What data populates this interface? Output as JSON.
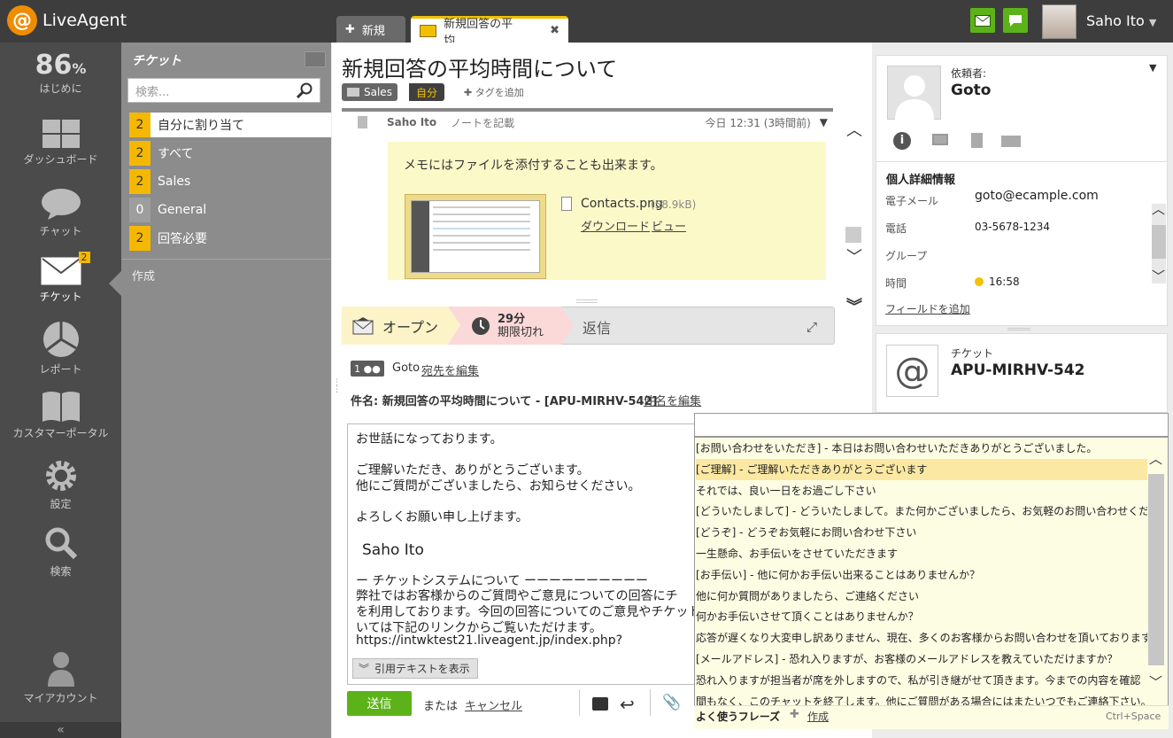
{
  "app": {
    "name": "LiveAgent",
    "user_name": "Saho Ito"
  },
  "tabs": [
    {
      "label": "新規"
    },
    {
      "label": "新規回答の平均..."
    }
  ],
  "nav": {
    "percent": "86",
    "percent_sign": "%",
    "items": [
      {
        "label": "はじめに",
        "icon": "progress"
      },
      {
        "label": "ダッシュボード",
        "icon": "dashboard-icon"
      },
      {
        "label": "チャット",
        "icon": "chat-bubble-icon"
      },
      {
        "label": "チケット",
        "icon": "envelope-icon",
        "badge": "2"
      },
      {
        "label": "レポート",
        "icon": "pie-chart-icon"
      },
      {
        "label": "カスタマーポータル",
        "icon": "book-icon"
      },
      {
        "label": "設定",
        "icon": "gear-icon"
      },
      {
        "label": "検索",
        "icon": "magnifier-icon"
      },
      {
        "label": "マイアカウント",
        "icon": "person-icon"
      }
    ],
    "collapse": "«"
  },
  "filters": {
    "title": "チケット",
    "search_placeholder": "検索...",
    "items": [
      {
        "count": "2",
        "label": "自分に割り当て"
      },
      {
        "count": "2",
        "label": "すべて"
      },
      {
        "count": "2",
        "label": "Sales"
      },
      {
        "count": "0",
        "label": "General"
      },
      {
        "count": "2",
        "label": "回答必要"
      }
    ],
    "create": "作成"
  },
  "ticket": {
    "title": "新規回答の平均時間について",
    "department": "Sales",
    "owner_tag": "自分",
    "add_tag": "タグを追加",
    "note": {
      "author": "Saho Ito",
      "action": "ノートを記載",
      "time": "今日 12:31 (3時間前)",
      "text": "メモにはファイルを添付することも出来ます。",
      "file_name": "Contacts.png",
      "file_size": "(58.9kB)",
      "download": "ダウンロード",
      "view": "ビュー"
    },
    "status": {
      "open": "オープン",
      "due_time": "29分",
      "due_label": "期限切れ",
      "reply": "返信"
    },
    "recipients": {
      "count": "1",
      "name": "Goto",
      "edit": "宛先を編集"
    },
    "subject": "件名: 新規回答の平均時間について - [APU-MIRHV-542]",
    "subject_edit": "件名を編集",
    "body": [
      "お世話になっております。",
      "ご理解いただき、ありがとうございます。",
      "他にご質問がございましたら、お知らせください。",
      "よろしくお願い申し上げます。",
      "Saho Ito",
      "ー  チケットシステムについて  ーーーーーーーーーー",
      "弊社ではお客様からのご質問やご意見についての回答にチ",
      "を利用しております。今回の回答についてのご意見やチケット",
      "いては下記のリンクからご覧いただけます。",
      "https://intwktest21.liveagent.jp/index.php?"
    ],
    "quote_toggle": "引用テキストを表示",
    "send": "送信",
    "or": "または",
    "cancel": "キャンセル"
  },
  "contact": {
    "requester_label": "依頼者:",
    "requester_name": "Goto",
    "details_title": "個人詳細情報",
    "fields": [
      {
        "label": "電子メール",
        "value": "goto@ecample.com"
      },
      {
        "label": "電話",
        "value": "03-5678-1234"
      },
      {
        "label": "グループ",
        "value": ""
      },
      {
        "label": "時間",
        "value": "16:58"
      }
    ],
    "add_field": "フィールドを追加"
  },
  "ticket_card": {
    "label": "チケット",
    "code": "APU-MIRHV-542"
  },
  "canned": {
    "items": [
      "[お問い合わせをいただき] - 本日はお問い合わせいただきありがとうございました。",
      "[ご理解] - ご理解いただきありがとうございます",
      "それでは、良い一日をお過ごし下さい",
      "[どういたしまして] - どういたしまして。また何かございましたら、お気軽のお問い合わせください",
      "[どうぞ] - どうぞお気軽にお問い合わせ下さい",
      "一生懸命、お手伝いをさせていただきます",
      "[お手伝い] - 他に何かお手伝い出来ることはありませんか？",
      "他に何か質問がありましたら、ご連絡ください",
      "何かお手伝いさせて頂くことはありませんか？",
      "応答が遅くなり大変申し訳ありません、現在、多くのお客様からお問い合わせを頂いております",
      "[メールアドレス] - 恐れ入りますが、お客様のメールアドレスを教えていただけますか？",
      "恐れ入りますが担当者が席を外しますので、私が引き継がせて頂きます。今までの内容を確認",
      "間もなく、このチャットを終了します。他にご質問がある場合にはまたいつでもご連絡下さい。あ"
    ],
    "highlighted_index": 1,
    "footer_label": "よく使うフレーズ",
    "create": "作成",
    "shortcut": "Ctrl+Space"
  },
  "colors": {
    "brand": "#f08c00",
    "green": "#5cb319",
    "count_badge": "#f5b800",
    "note_bg": "#fcf9c9"
  }
}
